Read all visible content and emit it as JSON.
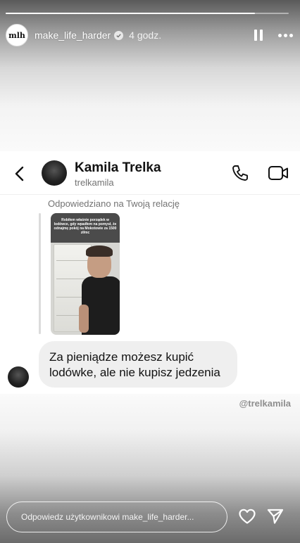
{
  "story": {
    "username": "make_life_harder",
    "time_ago": "4 godz.",
    "avatar_text": "mlh",
    "progress": 0.88
  },
  "dm": {
    "name": "Kamila Trelka",
    "handle": "trelkamila",
    "replied_label": "Odpowiedziano na Twoją relację",
    "story_caption": "Robiłem właśnie porządek w lodówce, gdy wpadłem na pomysł, że odnajmę pokój na Mokotowie za 1500 zł/mc",
    "message_line1": "Za pieniądze możesz kupić",
    "message_line2": "lodówke, ale nie kupisz jedzenia"
  },
  "credit": "@trelkamila",
  "reply": {
    "placeholder": "Odpowiedz użytkownikowi make_life_harder..."
  },
  "icons": {
    "back": "chevron-left-icon",
    "call": "phone-icon",
    "video": "video-camera-icon",
    "pause": "pause-icon",
    "more": "more-horizontal-icon",
    "like": "heart-icon",
    "send": "send-icon",
    "verified": "verified-badge-icon"
  }
}
